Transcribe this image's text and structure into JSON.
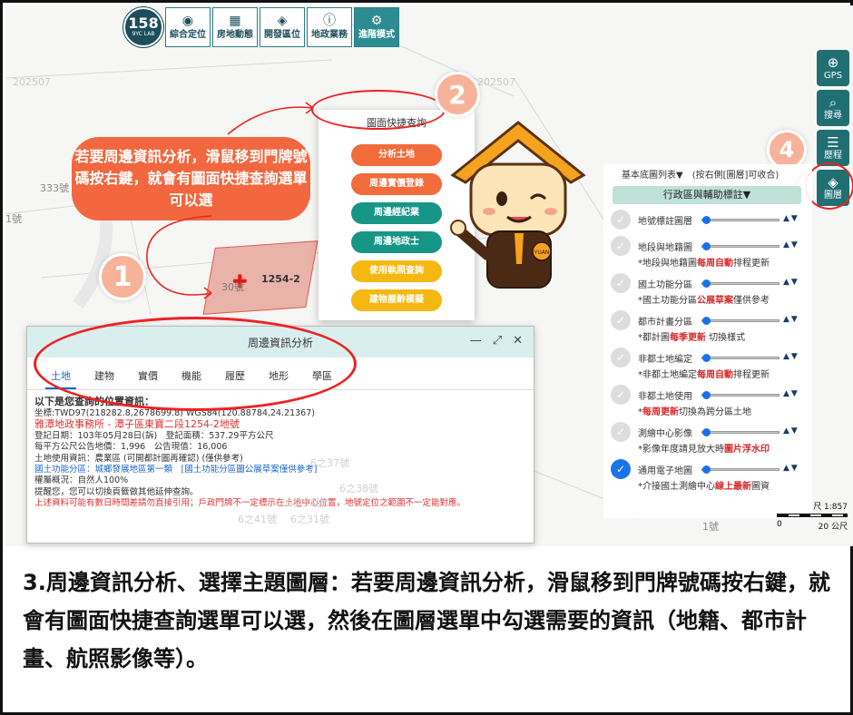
{
  "toolbar": {
    "logo_num": "158",
    "logo_sub": "9YC LAB",
    "items": [
      {
        "label": "綜合定位",
        "icon": "location-pin-icon",
        "glyph": "◉"
      },
      {
        "label": "房地動態",
        "icon": "building-icon",
        "glyph": "▦"
      },
      {
        "label": "開發區位",
        "icon": "layers-icon",
        "glyph": "◈"
      },
      {
        "label": "地政業務",
        "icon": "info-icon",
        "glyph": "ⓘ"
      },
      {
        "label": "進階模式",
        "icon": "gear-icon",
        "glyph": "⚙"
      }
    ]
  },
  "right_toolbar": {
    "items": [
      {
        "label": "GPS",
        "icon": "gps-icon",
        "glyph": "⊕"
      },
      {
        "label": "搜尋",
        "icon": "search-icon",
        "glyph": "⌕"
      },
      {
        "label": "歷程",
        "icon": "history-icon",
        "glyph": "☰"
      },
      {
        "label": "圖層",
        "icon": "layers-icon",
        "glyph": "◈"
      }
    ]
  },
  "map_labels": {
    "a": "202507",
    "b": "202507",
    "c": "333號",
    "d": "1號",
    "e": "30號",
    "f": "1254-2",
    "g": "1號",
    "h": "6之37號",
    "i": "6之38號",
    "j": "6之33號",
    "k": "6之41號",
    "l": "6之31號"
  },
  "callout": {
    "text": "若要周邊資訊分析，滑鼠移到門牌號碼按右鍵，就會有圖面快捷查詢選單可以選"
  },
  "steps": [
    "1",
    "2",
    "3",
    "4"
  ],
  "quick_menu": {
    "title": "圖面快捷查詢",
    "items": [
      {
        "label": "分析土地",
        "color": "#f26b3a"
      },
      {
        "label": "周邊實價登錄",
        "color": "#f26b3a"
      },
      {
        "label": "周邊經紀業",
        "color": "#179688"
      },
      {
        "label": "周邊地政士",
        "color": "#179688"
      },
      {
        "label": "使用執照查詢",
        "color": "#f5b812"
      },
      {
        "label": "建物屋齡模擬",
        "color": "#f5b812"
      }
    ]
  },
  "mascot": {
    "badge": "YUAN"
  },
  "analysis": {
    "title": "周邊資訊分析",
    "controls": [
      "—",
      "⤢",
      "✕"
    ],
    "tabs": [
      "土地",
      "建物",
      "實價",
      "機能",
      "履歷",
      "地形",
      "學區"
    ],
    "lines": {
      "heading": "以下是您查詢的位置資訊：",
      "coord": "坐標:TWD97(218282.8,2678699.8) WGS84(120.88784,24.21367)",
      "office": "雅潭地政事務所 - 潭子區東寶二段1254-2地號",
      "reg": "登記日期：103年05月28日(訴)　登記面積：537.29平方公尺",
      "price": "每平方公尺公告地價：1,996　公告現值：16,006",
      "use": "土地使用資訊：農業區 (可開都計圖再確認) (僅供參考)",
      "func": "國土功能分區：城鄉發展地區第一類　[國土功能分區圖公展草案僅供參考]",
      "owner": "權屬概況：自然人100%",
      "tip": "提醒您，您可以切換頁籤做其他延伸查詢。",
      "warn": "上述資料可能有數日時間差請勿直接引用；戶政門牌不一定標示在土地中心位置，地號定位之範圍不一定能對應。"
    }
  },
  "layers": {
    "header": "基本底圖列表▼　(按右側[圖層]可收合)",
    "section": "行政區與輔助標註▼",
    "rows": [
      {
        "name": "地號標註圖層",
        "checked": false,
        "level": 0.0,
        "note_pre": "",
        "note_em": "",
        "note_post": ""
      },
      {
        "name": "地段與地籍圖",
        "checked": false,
        "level": 0.0,
        "note_pre": "*地段與地籍圖",
        "note_em": "每周自動",
        "note_post": "排程更新"
      },
      {
        "name": "國土功能分區",
        "checked": false,
        "level": 0.0,
        "note_pre": "*國土功能分區",
        "note_em": "公展草案",
        "note_post": "僅供參考"
      },
      {
        "name": "都市計畫分區",
        "checked": false,
        "level": 0.0,
        "note_pre": "*都計圖",
        "note_em": "每季更新",
        "note_post": " 切換樣式"
      },
      {
        "name": "非都土地編定",
        "checked": false,
        "level": 0.0,
        "note_pre": "*非都土地編定",
        "note_em": "每周自動",
        "note_post": "排程更新"
      },
      {
        "name": "非都土地使用",
        "checked": false,
        "level": 0.0,
        "note_pre": "*",
        "note_em": "每周更新",
        "note_post": "切換為跨分區土地"
      },
      {
        "name": "測繪中心影像",
        "checked": false,
        "level": 0.0,
        "note_pre": "*影像年度請見放大時",
        "note_em": "圖片浮水印",
        "note_post": ""
      },
      {
        "name": "通用電子地圖",
        "checked": true,
        "level": 0.0,
        "note_pre": "*介接國土測繪中心",
        "note_em": "線上最新",
        "note_post": "圖資"
      }
    ]
  },
  "scale": {
    "ratio": "尺 1:857",
    "min": "0",
    "max": "20 公尺"
  },
  "caption": {
    "text": "3.周邊資訊分析、選擇主題圖層：若要周邊資訊分析，滑鼠移到門牌號碼按右鍵，就會有圖面快捷查詢選單可以選，然後在圖層選單中勾選需要的資訊（地籍、都市計畫、航照影像等）。"
  }
}
